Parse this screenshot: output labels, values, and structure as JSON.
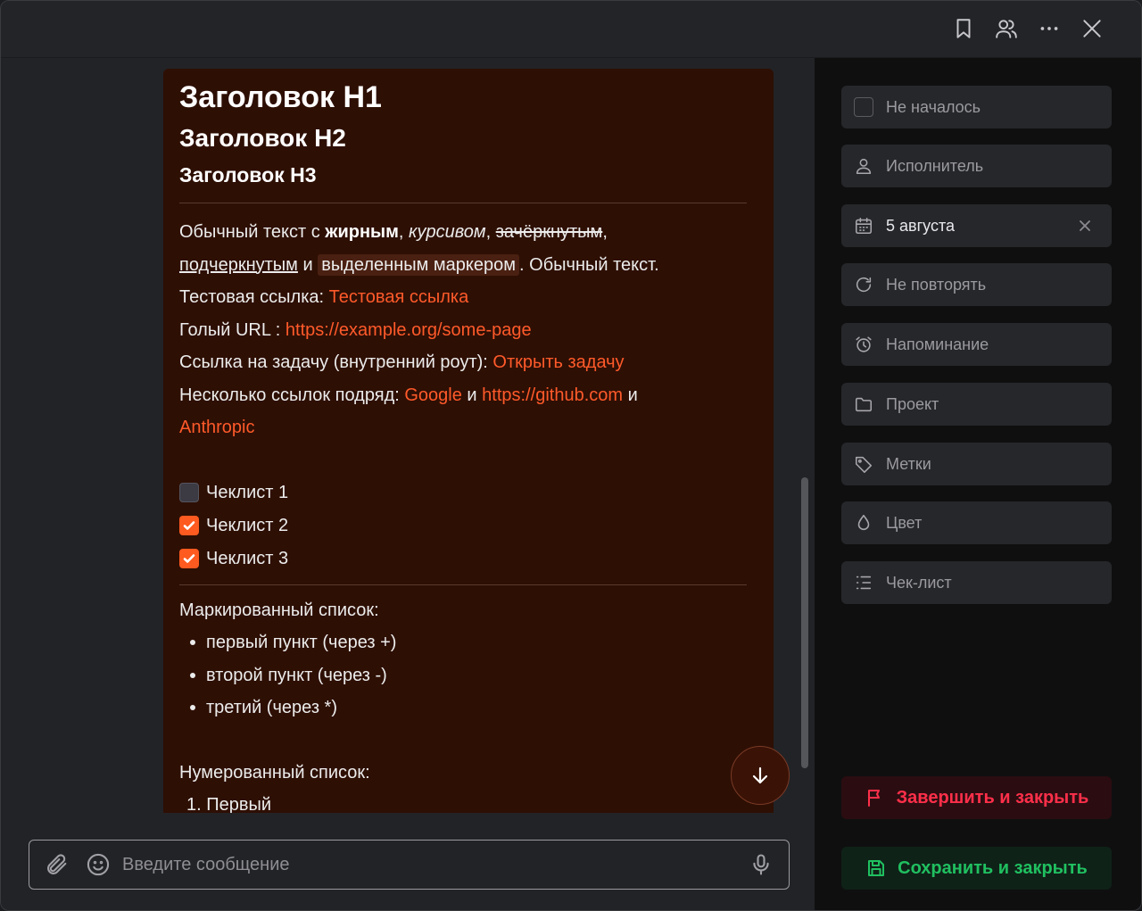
{
  "note": {
    "h1": "Заголовок H1",
    "h2": "Заголовок H2",
    "h3": "Заголовок H3",
    "line1": {
      "prefix": "Обычный текст с ",
      "bold": "жирным",
      "sep1": ", ",
      "italic": "курсивом",
      "sep2": ", ",
      "strike": "зачёркнутым",
      "sep3": ","
    },
    "line2": {
      "underline": "подчеркнутым",
      "sep": " и ",
      "highlight": "выделенным маркером",
      "suffix": ". Обычный текст."
    },
    "line3": {
      "prefix": "Тестовая ссылка: ",
      "link": "Тестовая ссылка"
    },
    "line4": {
      "prefix": "Голый URL : ",
      "link": "https://example.org/some-page"
    },
    "line5": {
      "prefix": "Ссылка на задачу (внутренний роут): ",
      "link": "Открыть задачу"
    },
    "line6": {
      "prefix": "Несколько ссылок подряд: ",
      "link1": "Google",
      "sep1": " и ",
      "link2": "https://github.com",
      "sep2": " и"
    },
    "line7": {
      "link": "Anthropic"
    },
    "checklist": [
      {
        "label": "Чеклист 1",
        "checked": false
      },
      {
        "label": "Чеклист 2",
        "checked": true
      },
      {
        "label": "Чеклист 3",
        "checked": true
      }
    ],
    "bullet_title": "Маркированный список:",
    "bullets": [
      "первый пункт (через +)",
      "второй пункт (через -)",
      "третий (через *)"
    ],
    "numbered_title": "Нумерованный список:",
    "numbered": [
      "1. Первый"
    ]
  },
  "composer": {
    "placeholder": "Введите сообщение"
  },
  "sidebar": {
    "status": "Не началось",
    "assignee": "Исполнитель",
    "date": "5 августа",
    "repeat": "Не повторять",
    "reminder": "Напоминание",
    "project": "Проект",
    "tags": "Метки",
    "color": "Цвет",
    "checklist": "Чек-лист"
  },
  "actions": {
    "finish": "Завершить и закрыть",
    "save": "Сохранить и закрыть"
  },
  "icons": {
    "top": [
      "bookmark-icon",
      "users-icon",
      "more-icon",
      "close-icon"
    ]
  },
  "colors": {
    "accent": "#ff5a2a",
    "note_bg": "#2e0f04",
    "danger": "#ff2f4a",
    "success": "#20c060"
  }
}
